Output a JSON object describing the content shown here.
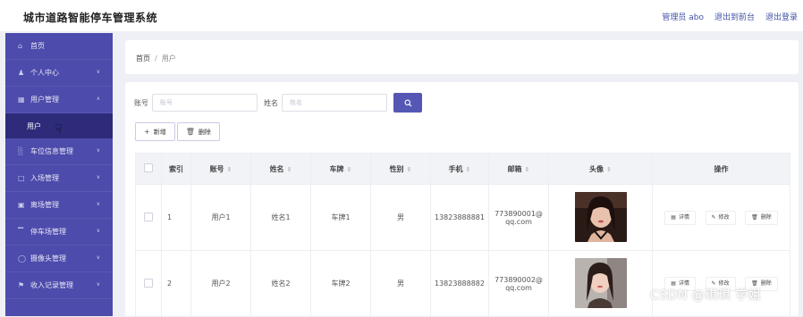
{
  "header": {
    "app_title": "城市道路智能停车管理系统",
    "admin_label": "管理员 abo",
    "back_label": "退出到前台",
    "logout_label": "退出登录"
  },
  "sidebar": {
    "items": [
      {
        "label": "首页",
        "icon": "home-icon",
        "has_chevron": false
      },
      {
        "label": "个人中心",
        "icon": "person-icon",
        "has_chevron": true
      },
      {
        "label": "用户管理",
        "icon": "grid-icon",
        "has_chevron": true,
        "expanded": true
      },
      {
        "label": "车位信息管理",
        "icon": "bar-chart-icon",
        "has_chevron": true
      },
      {
        "label": "入场管理",
        "icon": "square-icon",
        "has_chevron": true
      },
      {
        "label": "离场管理",
        "icon": "card-icon",
        "has_chevron": true
      },
      {
        "label": "停车场管理",
        "icon": "building-icon",
        "has_chevron": true
      },
      {
        "label": "摄像头管理",
        "icon": "camera-icon",
        "has_chevron": true
      },
      {
        "label": "收入记录管理",
        "icon": "flag-icon",
        "has_chevron": true
      }
    ],
    "active_sub": "用户"
  },
  "breadcrumb": {
    "home": "首页",
    "separator": "/",
    "current": "用户"
  },
  "search": {
    "account_label": "账号",
    "account_placeholder": "账号",
    "name_label": "姓名",
    "name_placeholder": "姓名",
    "search_icon": "search-icon"
  },
  "actions": {
    "add_label": "新增",
    "delete_label": "删除"
  },
  "table": {
    "headers": [
      "索引",
      "账号",
      "姓名",
      "车牌",
      "性别",
      "手机",
      "邮箱",
      "头像",
      "操作"
    ],
    "rows": [
      {
        "index": "1",
        "account": "用户1",
        "name": "姓名1",
        "plate": "车牌1",
        "gender": "男",
        "phone": "13823888881",
        "email_line1": "773890001@",
        "email_line2": "qq.com"
      },
      {
        "index": "2",
        "account": "用户2",
        "name": "姓名2",
        "plate": "车牌2",
        "gender": "男",
        "phone": "13823888882",
        "email_line1": "773890002@",
        "email_line2": "qq.com"
      }
    ],
    "ops": {
      "detail": "详情",
      "edit": "修改",
      "delete": "删除"
    }
  },
  "watermark": "CSDN @琪琪 学姐",
  "colors": {
    "sidebar": "#4d4bab",
    "sidebar_active": "#2d2b7a",
    "accent": "#5557b5"
  }
}
